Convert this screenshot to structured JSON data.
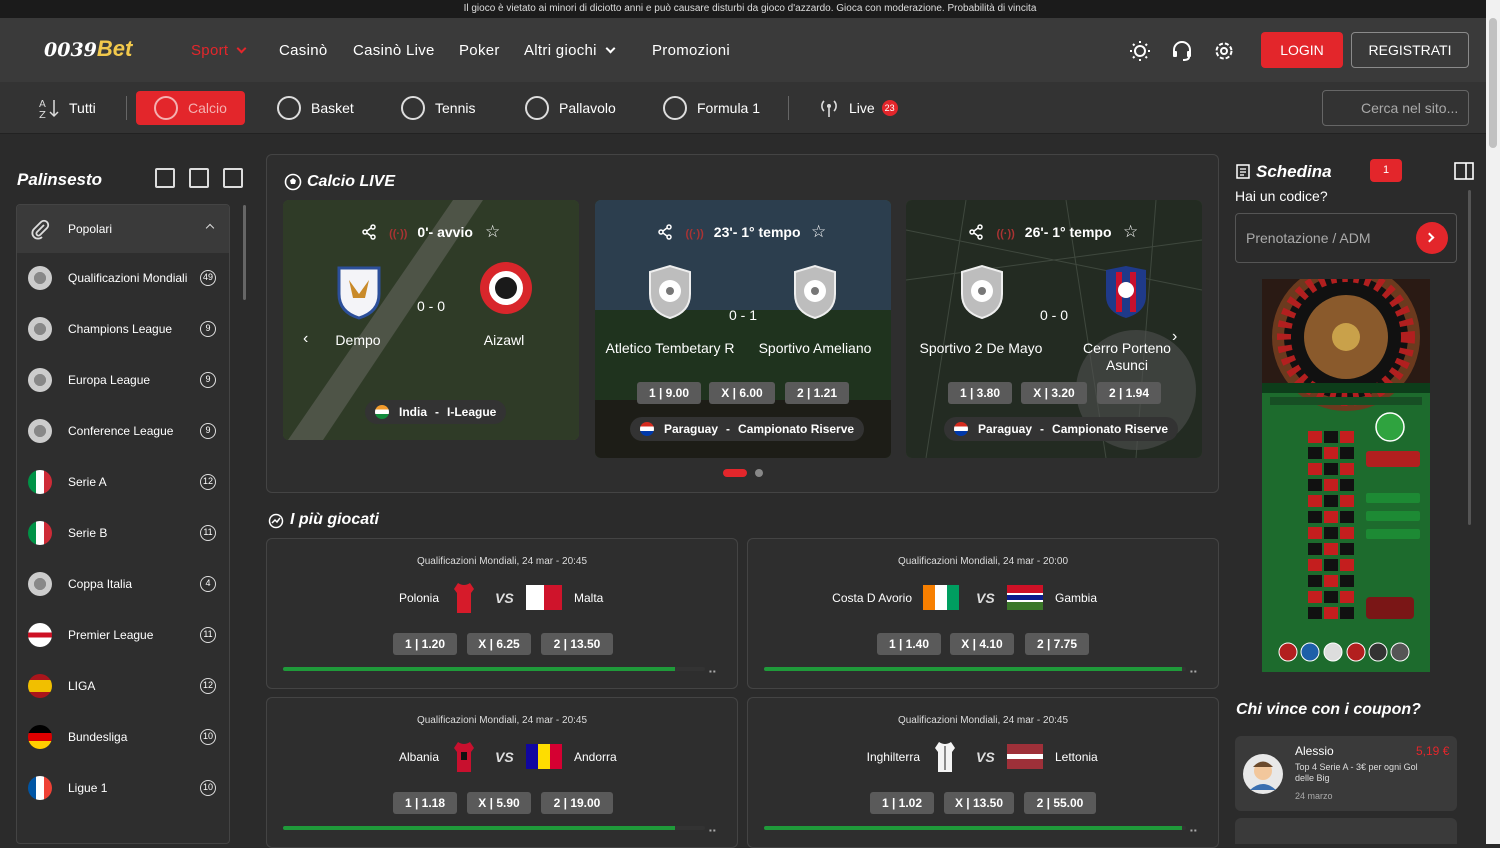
{
  "notice": "Il gioco è vietato ai minori di diciotto anni e può causare disturbi da gioco d'azzardo. Gioca con moderazione. Probabilità di vincita",
  "logo": {
    "num": "0039",
    "brand": "Bet"
  },
  "mainnav": [
    "Sport",
    "Casinò",
    "Casinò Live",
    "Poker",
    "Altri giochi",
    "Promozioni"
  ],
  "auth": {
    "login": "LOGIN",
    "register": "REGISTRATI"
  },
  "sports": {
    "all": "Tutti",
    "soccer": "Calcio",
    "basket": "Basket",
    "tennis": "Tennis",
    "volley": "Pallavolo",
    "f1": "Formula 1",
    "live": "Live",
    "live_count": "23"
  },
  "search": {
    "placeholder": "Cerca nel sito..."
  },
  "sidebar": {
    "title": "Palinsesto",
    "popular": "Popolari",
    "items": [
      {
        "label": "Qualificazioni Mondiali",
        "count": "49"
      },
      {
        "label": "Champions League",
        "count": "9"
      },
      {
        "label": "Europa League",
        "count": "9"
      },
      {
        "label": "Conference League",
        "count": "9"
      },
      {
        "label": "Serie A",
        "count": "12"
      },
      {
        "label": "Serie B",
        "count": "11"
      },
      {
        "label": "Coppa Italia",
        "count": "4"
      },
      {
        "label": "Premier League",
        "count": "11"
      },
      {
        "label": "LIGA",
        "count": "12"
      },
      {
        "label": "Bundesliga",
        "count": "10"
      },
      {
        "label": "Ligue 1",
        "count": "10"
      }
    ]
  },
  "live": {
    "title": "Calcio LIVE",
    "cards": [
      {
        "time": "0'- avvio",
        "home": "Dempo",
        "away": "Aizawl",
        "score": "0 - 0",
        "country": "India",
        "league": "I-League",
        "odds": []
      },
      {
        "time": "23'- 1° tempo",
        "home": "Atletico Tembetary R",
        "away": "Sportivo Ameliano",
        "score": "0 - 1",
        "country": "Paraguay",
        "league": "Campionato Riserve",
        "odds": [
          "1 | 9.00",
          "X | 6.00",
          "2 | 1.21"
        ]
      },
      {
        "time": "26'- 1° tempo",
        "home": "Sportivo 2 De Mayo",
        "away": "Cerro Porteno Asunci",
        "score": "0 - 0",
        "country": "Paraguay",
        "league": "Campionato Riserve",
        "odds": [
          "1 | 3.80",
          "X | 3.20",
          "2 | 1.94"
        ]
      }
    ]
  },
  "popular": {
    "title": "I più giocati",
    "vs": "VS",
    "matches": [
      {
        "meta": "Qualificazioni Mondiali, 24 mar - 20:45",
        "home": "Polonia",
        "away": "Malta",
        "odds": [
          "1 | 1.20",
          "X | 6.25",
          "2 | 13.50"
        ],
        "progress": 0.93
      },
      {
        "meta": "Qualificazioni Mondiali, 24 mar - 20:00",
        "home": "Costa D Avorio",
        "away": "Gambia",
        "odds": [
          "1 | 1.40",
          "X | 4.10",
          "2 | 7.75"
        ],
        "progress": 0.99
      },
      {
        "meta": "Qualificazioni Mondiali, 24 mar - 20:45",
        "home": "Albania",
        "away": "Andorra",
        "odds": [
          "1 | 1.18",
          "X | 5.90",
          "2 | 19.00"
        ],
        "progress": 0.93
      },
      {
        "meta": "Qualificazioni Mondiali, 24 mar - 20:45",
        "home": "Inghilterra",
        "away": "Lettonia",
        "odds": [
          "1 | 1.02",
          "X | 13.50",
          "2 | 55.00"
        ],
        "progress": 0.99
      }
    ]
  },
  "betslip": {
    "title": "Schedina",
    "count": "1",
    "code_q": "Hai un codice?",
    "code_placeholder": "Prenotazione / ADM"
  },
  "winners": {
    "title": "Chi vince con i coupon?",
    "items": [
      {
        "name": "Alessio",
        "amount": "5,19 €",
        "desc": "Top 4 Serie A - 3€ per ogni Gol delle Big",
        "date": "24 marzo"
      }
    ]
  },
  "colors": {
    "accent": "#e3262b",
    "bg": "#2b2b2b",
    "progress": "#1f9a3a"
  }
}
